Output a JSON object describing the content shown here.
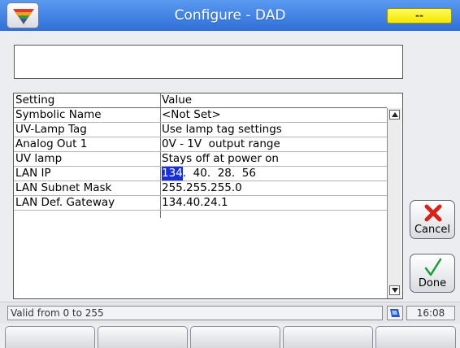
{
  "title": "Configure - DAD",
  "status_badge": "--",
  "message": "",
  "table": {
    "headers": [
      "Setting",
      "Value"
    ],
    "rows": [
      {
        "setting": "Symbolic Name",
        "value": "<Not Set>"
      },
      {
        "setting": "UV-Lamp Tag",
        "value": "Use lamp tag settings"
      },
      {
        "setting": "Analog Out 1",
        "value": "0V - 1V  output range"
      },
      {
        "setting": "UV lamp",
        "value": "Stays off at power on"
      },
      {
        "setting": "LAN IP",
        "ip_segments": [
          "134",
          "40",
          "28",
          "56"
        ],
        "selected_segment": 0
      },
      {
        "setting": "LAN Subnet Mask",
        "value": "255.255.255.0"
      },
      {
        "setting": "LAN Def. Gateway",
        "value": "134.40.24.1"
      }
    ]
  },
  "buttons": {
    "cancel": "Cancel",
    "done": "Done"
  },
  "status": {
    "text": "Valid from 0 to 255",
    "time": "16:08"
  },
  "icons": {
    "logo": "triangle-logo-icon",
    "cancel": "red-x-icon",
    "done": "green-check-icon",
    "network": "network-icon"
  },
  "colors": {
    "titlebar": "#3b7fe3",
    "badge": "#f7ea00",
    "selection": "#1a2fd6"
  }
}
